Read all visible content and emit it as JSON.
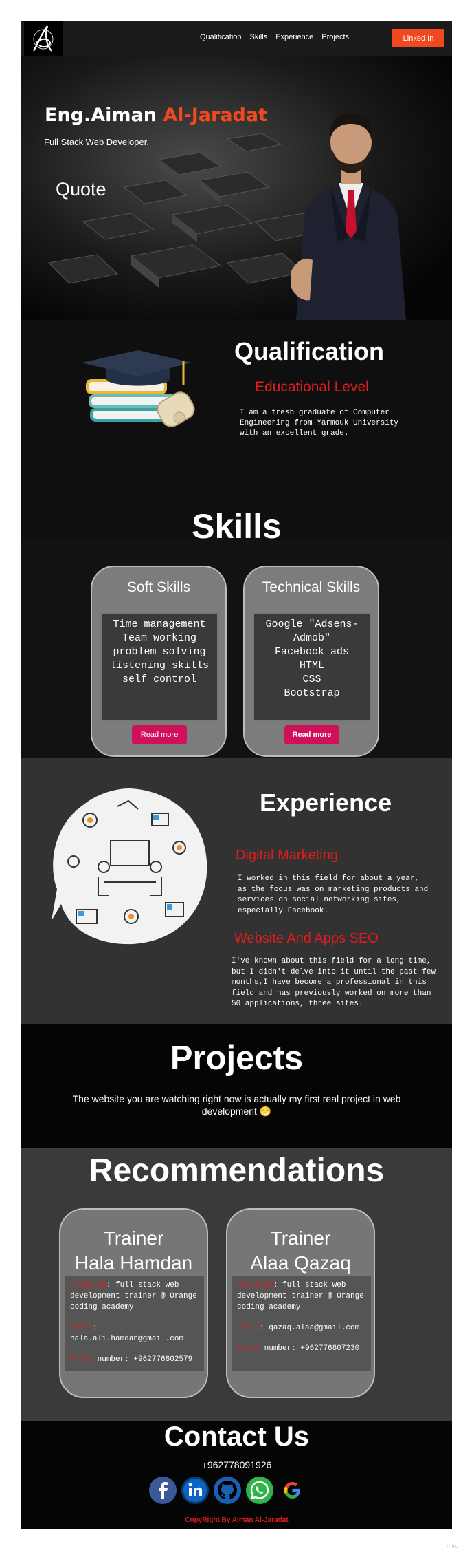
{
  "nav": {
    "links": [
      "Qualification",
      "Skills",
      "Experience",
      "Projects"
    ],
    "linkedin_label": "Linked In"
  },
  "hero": {
    "name_first": "Eng.Aiman ",
    "name_last": "Al-Jaradat",
    "role": "Full Stack Web Developer.",
    "quote": "Quote"
  },
  "qualification": {
    "title": "Qualification",
    "subtitle": "Educational Level",
    "text": "I am a fresh graduate of Computer Engineering from Yarmouk University with an excellent grade."
  },
  "skills": {
    "title": "Skills",
    "cards": [
      {
        "title": "Soft Skills",
        "items": [
          "Time management",
          "Team working",
          "problem solving",
          "listening skills",
          "self control"
        ],
        "button": "Read more"
      },
      {
        "title": "Technical Skills",
        "items": [
          "Google \"Adsens-",
          "Admob\"",
          "Facebook ads",
          "HTML",
          "CSS",
          "Bootstrap"
        ],
        "button": "Read more"
      }
    ]
  },
  "experience": {
    "title": "Experience",
    "items": [
      {
        "heading": "Digital Marketing",
        "text": "I worked in this field for about a year, as the focus was on marketing products and services on social networking sites, especially Facebook."
      },
      {
        "heading": "Website And Apps SEO",
        "text": "I've known about this field for a long time, but I didn't delve into it until the past few months,I have become a professional in this field and has previously worked on more than 50 applications, three sites."
      }
    ]
  },
  "projects": {
    "title": "Projects",
    "text": "The website you are watching right now is actually my first real project in web development 😁"
  },
  "recommendations": {
    "title": "Recommendations",
    "cards": [
      {
        "name_line1": "Trainer",
        "name_line2": "Hala Hamdan",
        "position_key": "Position",
        "position_val": ": full stack web development trainer @ Orange coding academy",
        "email_key": "Email",
        "email_val": ": hala.ali.hamdan@gmail.com",
        "phone_key": "Phone",
        "phone_val": " number: +962776802579"
      },
      {
        "name_line1": "Trainer",
        "name_line2": "Alaa Qazaq",
        "position_key": "Position",
        "position_val": ": full stack web development trainer @ Orange coding academy",
        "email_key": "Email",
        "email_val": ": qazaq.alaa@gmail.com",
        "phone_key": "Phone",
        "phone_val": " number: +962776807230"
      }
    ]
  },
  "contact": {
    "title": "Contact Us",
    "phone": "+962778091926",
    "social_icons": [
      "facebook-icon",
      "linkedin-icon",
      "github-icon",
      "whatsapp-icon",
      "google-icon"
    ],
    "copyright": "CopyRight By Aiman Al-Jaradat"
  },
  "watermark": "miro",
  "colors": {
    "accent": "#f0481f",
    "red": "#e11c1c",
    "button_pink": "#d0105b"
  }
}
